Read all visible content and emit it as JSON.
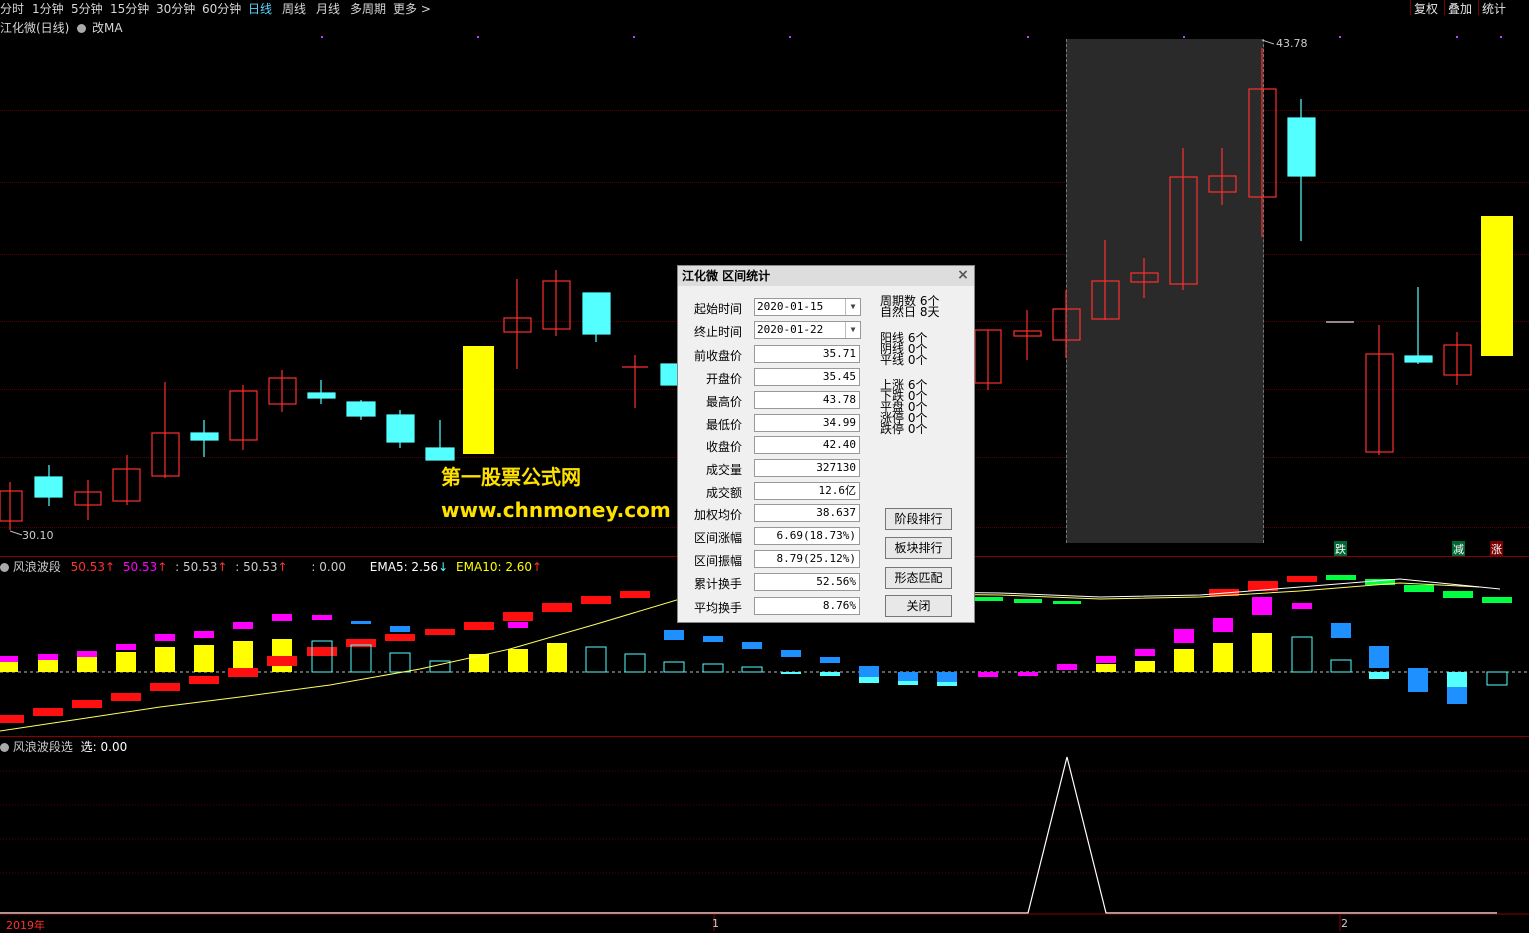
{
  "toolbar": {
    "timeframes": [
      "分时",
      "1分钟",
      "5分钟",
      "15分钟",
      "30分钟",
      "60分钟",
      "日线",
      "周线",
      "月线",
      "多周期",
      "更多 >"
    ],
    "active": "日线",
    "right_buttons": [
      "复权",
      "叠加",
      "统计"
    ]
  },
  "main_chart": {
    "title": "江化微(日线)",
    "ma_label": "改MA",
    "high_label": "43.78",
    "low_label": "30.10",
    "signals": [
      "跌",
      "减",
      "涨"
    ]
  },
  "indicator1": {
    "name": "风浪波段",
    "v1": "50.53",
    "v2": "50.53",
    "v3": ": 50.53",
    "v4": ": 50.53",
    "v5": ": 0.00",
    "ema5": "EMA5: 2.56",
    "ema10": "EMA10: 2.60"
  },
  "indicator2": {
    "name": "风浪波段选",
    "value": "选: 0.00"
  },
  "xaxis": {
    "year": "2019年",
    "m1": "1",
    "m2": "2"
  },
  "watermark": {
    "line1": "第一股票公式网",
    "line2": "www.chnmoney.com"
  },
  "dialog": {
    "title": "江化微 区间统计",
    "start_label": "起始时间",
    "start_value": "2020-01-15",
    "end_label": "终止时间",
    "end_value": "2020-01-22",
    "rows": [
      {
        "label": "前收盘价",
        "value": "35.71"
      },
      {
        "label": "开盘价",
        "value": "35.45"
      },
      {
        "label": "最高价",
        "value": "43.78"
      },
      {
        "label": "最低价",
        "value": "34.99"
      },
      {
        "label": "收盘价",
        "value": "42.40"
      },
      {
        "label": "成交量",
        "value": "327130"
      },
      {
        "label": "成交额",
        "value": "12.6亿"
      },
      {
        "label": "加权均价",
        "value": "38.637"
      },
      {
        "label": "区间涨幅",
        "value": "6.69(18.73%)"
      },
      {
        "label": "区间振幅",
        "value": "8.79(25.12%)"
      },
      {
        "label": "累计换手",
        "value": "52.56%"
      },
      {
        "label": "平均换手",
        "value": "8.76%"
      }
    ],
    "stats": [
      {
        "label": "周期数",
        "value": "6个"
      },
      {
        "label": "自然日",
        "value": "8天"
      },
      {
        "label": "阳线",
        "value": "6个"
      },
      {
        "label": "阴线",
        "value": "0个"
      },
      {
        "label": "平线",
        "value": "0个"
      },
      {
        "label": "上涨",
        "value": "6个"
      },
      {
        "label": "下跌",
        "value": "0个"
      },
      {
        "label": "平盘",
        "value": "0个"
      },
      {
        "label": "涨停",
        "value": "0个"
      },
      {
        "label": "跌停",
        "value": "0个"
      }
    ],
    "buttons": [
      "阶段排行",
      "板块排行",
      "形态匹配",
      "关闭"
    ]
  },
  "colors": {
    "up": "#ff3030",
    "down": "#54ffff",
    "yellow": "#ffff00",
    "magenta": "#ff00ff",
    "blue": "#1e90ff",
    "green": "#00ff40"
  }
}
